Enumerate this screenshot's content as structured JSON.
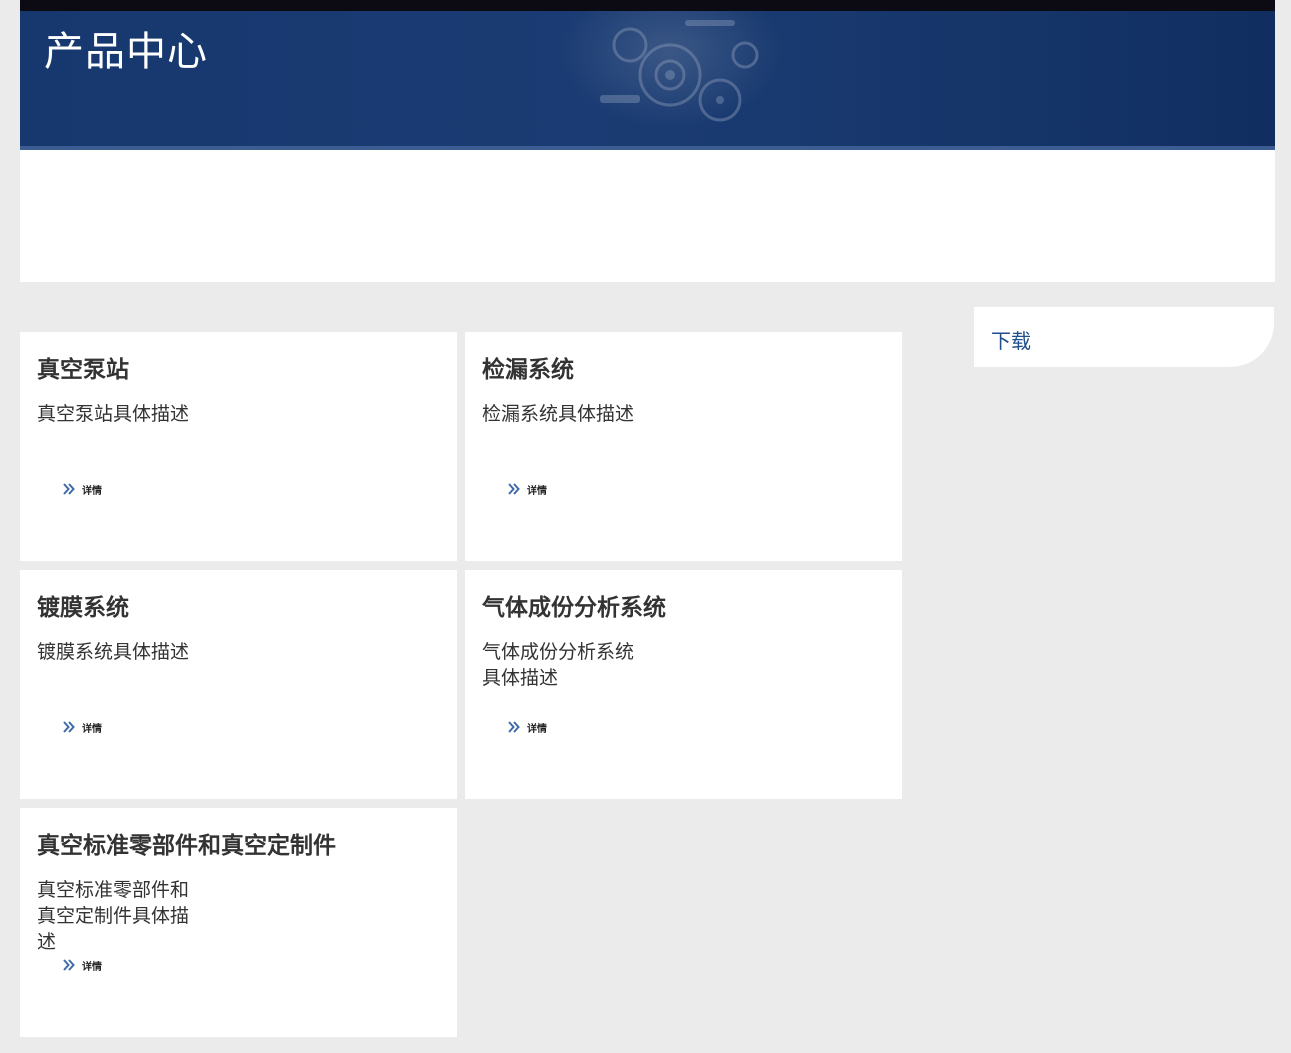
{
  "header": {
    "title": "产品中心"
  },
  "products": [
    {
      "title": "真空泵站",
      "description": "真空泵站具体描述",
      "more_label": "详情"
    },
    {
      "title": "检漏系统",
      "description": "检漏系统具体描述",
      "more_label": "详情"
    },
    {
      "title": "镀膜系统",
      "description": "镀膜系统具体描述",
      "more_label": "详情"
    },
    {
      "title": "气体成份分析系统",
      "description": "气体成份分析系统具体描述",
      "more_label": "详情"
    },
    {
      "title": "真空标准零部件和真空定制件",
      "description": "真空标准零部件和真空定制件具体描述",
      "more_label": "详情"
    }
  ],
  "sidebar": {
    "link_label": "下载"
  },
  "colors": {
    "banner": "#1a3b73",
    "page_background": "#ebebeb",
    "link": "#1f4e8c",
    "chevron": "#3f6aa8"
  },
  "icons": {
    "more": "double-chevron-right-icon"
  }
}
